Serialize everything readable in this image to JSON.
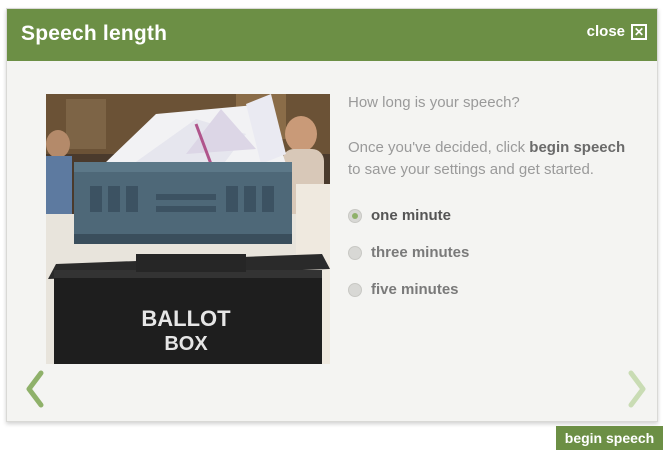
{
  "dialog": {
    "title": "Speech length",
    "close_label": "close",
    "close_icon": "close-box-icon"
  },
  "photo": {
    "box_label_line1": "BALLOT",
    "box_label_line2": "BOX"
  },
  "content": {
    "question": "How long is your speech?",
    "instructions": {
      "part1": "Once you've decided, click ",
      "bold": "begin speech",
      "part2": " to save your settings and get started."
    },
    "options": [
      {
        "label": "one minute",
        "selected": true
      },
      {
        "label": "three minutes",
        "selected": false
      },
      {
        "label": "five minutes",
        "selected": false
      }
    ]
  },
  "navigation": {
    "prev_icon": "chevron-left-icon",
    "next_icon": "chevron-right-icon"
  },
  "footer": {
    "begin_label": "begin speech"
  },
  "colors": {
    "header_green": "#6c8f45",
    "arrow_prev": "#8fb16a",
    "arrow_next": "#c9dcb4",
    "panel_bg": "#f4f4f2"
  }
}
